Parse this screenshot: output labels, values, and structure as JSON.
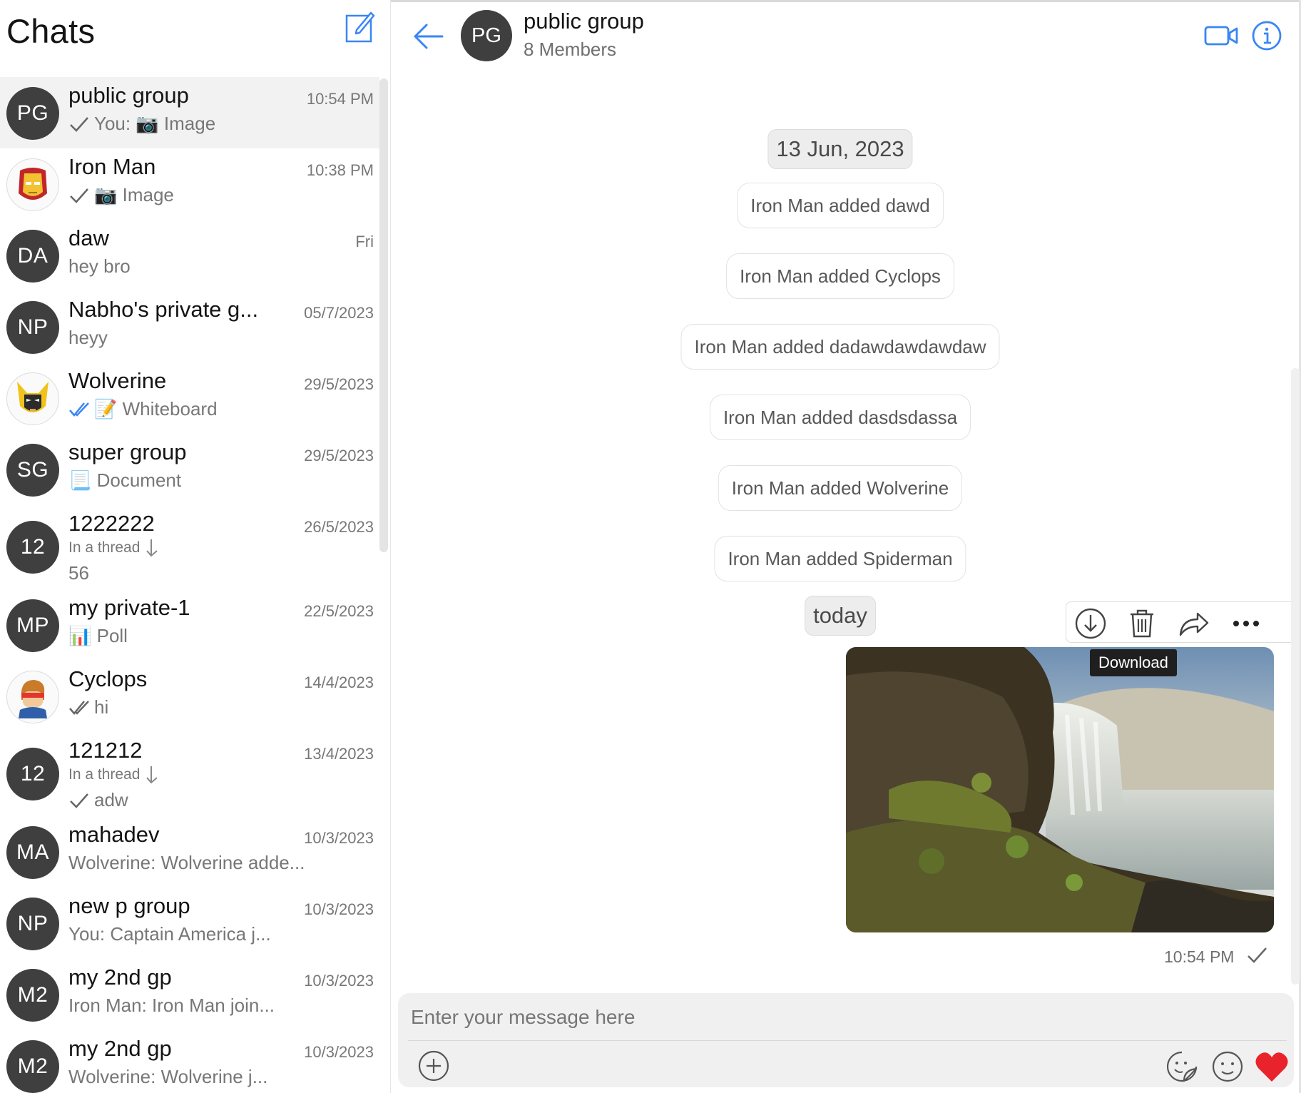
{
  "sidebar": {
    "title": "Chats",
    "chats": [
      {
        "initials": "PG",
        "name": "public group",
        "time": "10:54 PM",
        "preview": "You: 📷 Image"
      },
      {
        "name": "Iron Man",
        "time": "10:38 PM",
        "preview": "📷 Image"
      },
      {
        "initials": "DA",
        "name": "daw",
        "time": "Fri",
        "preview": "hey bro"
      },
      {
        "initials": "NP",
        "name": "Nabho's private g...",
        "time": "05/7/2023",
        "preview": "heyy"
      },
      {
        "name": "Wolverine",
        "time": "29/5/2023",
        "preview": "📝 Whiteboard"
      },
      {
        "initials": "SG",
        "name": "super group",
        "time": "29/5/2023",
        "preview": "📃 Document"
      },
      {
        "initials": "12",
        "name": "1222222",
        "time": "26/5/2023",
        "thread": "In a thread",
        "preview": "56"
      },
      {
        "initials": "MP",
        "name": "my private-1",
        "time": "22/5/2023",
        "preview": "📊 Poll"
      },
      {
        "name": "Cyclops",
        "time": "14/4/2023",
        "preview": "hi"
      },
      {
        "initials": "12",
        "name": "121212",
        "time": "13/4/2023",
        "thread": "In a thread",
        "preview": "adw"
      },
      {
        "initials": "MA",
        "name": "mahadev",
        "time": "10/3/2023",
        "preview": "Wolverine: Wolverine adde..."
      },
      {
        "initials": "NP",
        "name": "new p group",
        "time": "10/3/2023",
        "preview": "You: Captain America j..."
      },
      {
        "initials": "M2",
        "name": "my 2nd gp",
        "time": "10/3/2023",
        "preview": "Iron Man: Iron Man join..."
      },
      {
        "initials": "M2",
        "name": "my 2nd gp",
        "time": "10/3/2023",
        "preview": "Wolverine: Wolverine j..."
      }
    ]
  },
  "header": {
    "initials": "PG",
    "name": "public group",
    "members": "8 Members"
  },
  "messages": {
    "date_1": "13 Jun, 2023",
    "actions": [
      "Iron Man added dawd",
      "Iron Man added Cyclops",
      "Iron Man added dadawdawdawdaw",
      "Iron Man added dasdsdassa",
      "Iron Man added Wolverine",
      "Iron Man added Spiderman"
    ],
    "date_2": "today",
    "tooltip": "Download",
    "image_time": "10:54 PM"
  },
  "composer": {
    "placeholder": "Enter your message here"
  },
  "colors": {
    "accent": "#3a86f5",
    "heart": "#e8232b",
    "avatar_bg": "#3f3f3f"
  },
  "icons": [
    "compose-icon",
    "back-arrow-icon",
    "video-call-icon",
    "info-icon",
    "download-icon",
    "trash-icon",
    "forward-icon",
    "more-icon",
    "plus-icon",
    "sticker-icon",
    "emoji-icon",
    "heart-icon",
    "check-icon",
    "double-check-icon",
    "thread-arrow-icon"
  ]
}
